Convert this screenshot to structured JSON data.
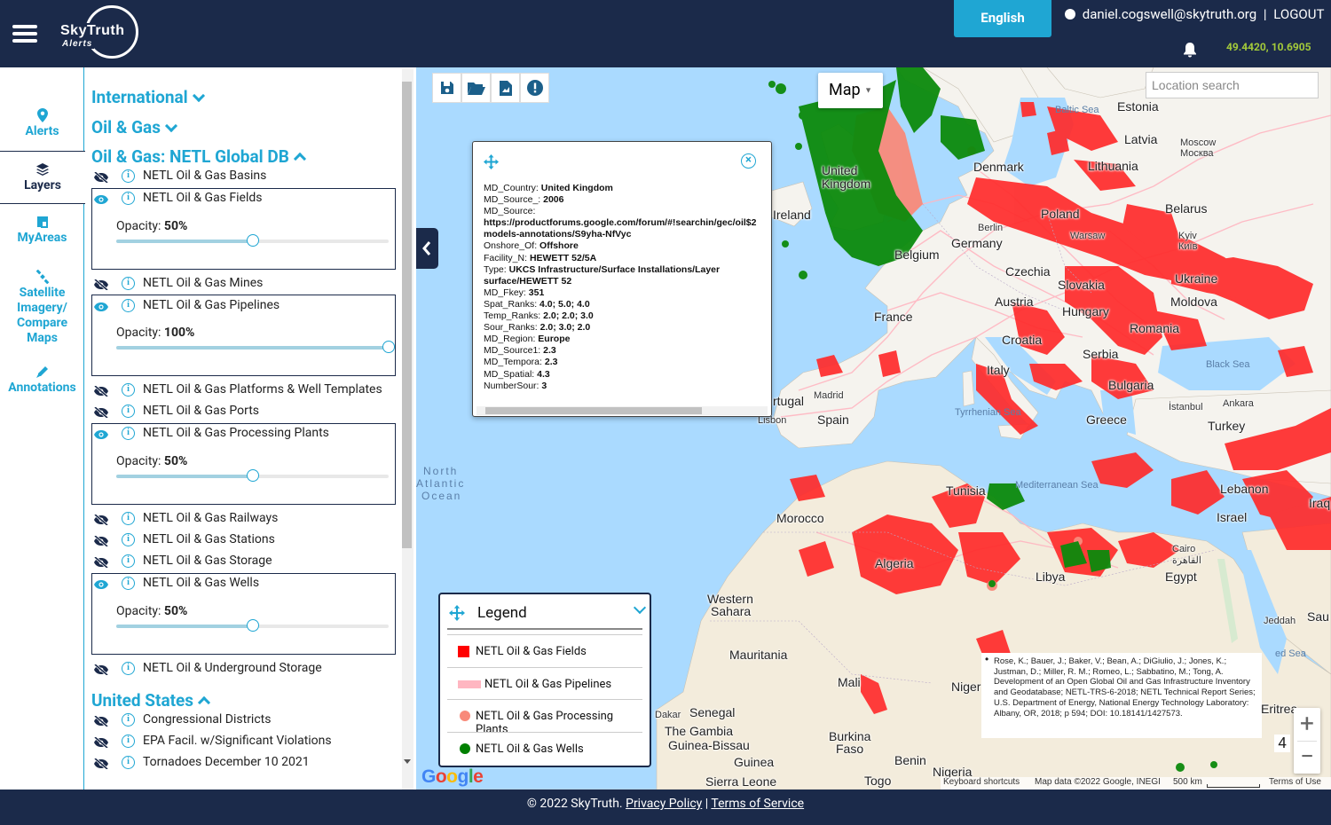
{
  "header": {
    "logo_text": "SkyTruth",
    "logo_sub": "Alerts",
    "language_button": "English",
    "user_email": "daniel.cogswell@skytruth.org",
    "separator": "|",
    "logout": "LOGOUT",
    "coordinates": "49.4420, 10.6905"
  },
  "nav": {
    "alerts": "Alerts",
    "layers": "Layers",
    "myareas": "MyAreas",
    "satellite_1": "Satellite",
    "satellite_2": "Imagery/",
    "satellite_3": "Compare",
    "satellite_4": "Maps",
    "annotations": "Annotations"
  },
  "panel": {
    "sections": {
      "international": "International",
      "oil_gas": "Oil & Gas",
      "netl": "Oil & Gas: NETL Global DB",
      "us": "United States"
    },
    "opacity_label": "Opacity:",
    "layers": [
      {
        "label": "NETL Oil & Gas Basins",
        "visible": false
      },
      {
        "label": "NETL Oil & Gas Fields",
        "visible": true,
        "opacity": "50%",
        "opacity_value": 0.5
      },
      {
        "label": "NETL Oil & Gas Mines",
        "visible": false
      },
      {
        "label": "NETL Oil & Gas Pipelines",
        "visible": true,
        "opacity": "100%",
        "opacity_value": 1.0
      },
      {
        "label": "NETL Oil & Gas Platforms & Well Templates",
        "visible": false
      },
      {
        "label": "NETL Oil & Gas Ports",
        "visible": false
      },
      {
        "label": "NETL Oil & Gas Processing Plants",
        "visible": true,
        "opacity": "50%",
        "opacity_value": 0.5
      },
      {
        "label": "NETL Oil & Gas Railways",
        "visible": false
      },
      {
        "label": "NETL Oil & Gas Stations",
        "visible": false
      },
      {
        "label": "NETL Oil & Gas Storage",
        "visible": false
      },
      {
        "label": "NETL Oil & Gas Wells",
        "visible": true,
        "opacity": "50%",
        "opacity_value": 0.5
      },
      {
        "label": "NETL Oil & Underground Storage",
        "visible": false
      }
    ],
    "us_layers": [
      {
        "label": "Congressional Districts",
        "visible": false
      },
      {
        "label": "EPA Facil. w/Significant Violations",
        "visible": false
      },
      {
        "label": "Tornadoes December 10 2021",
        "visible": false
      }
    ]
  },
  "map": {
    "type_label": "Map",
    "search_placeholder": "Location search",
    "zoom_level": "4",
    "google": "Google",
    "footer_shortcuts": "Keyboard shortcuts",
    "footer_data": "Map data ©2022 Google, INEGI",
    "footer_scale": "500 km",
    "footer_terms": "Terms of Use",
    "attribution": "Rose, K.; Bauer, J.; Baker, V.; Bean, A.; DiGiulio, J.; Jones, K.; Justman, D.; Miller, R. M.; Romeo, L.; Sabbatino, M.; Tong, A. Development of an Open Global Oil and Gas Infrastructure Inventory and Geodatabase; NETL-TRS-6-2018; NETL Technical Report Series; U.S. Department of Energy, National Energy Technology Laboratory: Albany, OR, 2018; p 594; DOI: 10.18141/1427573.",
    "labels": {
      "estonia": "Estonia",
      "latvia": "Latvia",
      "lithuania": "Lithuania",
      "moscow": "Moscow",
      "moscow_ru": "Москва",
      "belarus": "Belarus",
      "poland": "Poland",
      "warsaw": "Warsaw",
      "kyiv": "Kyiv",
      "kyiv_ua": "Київ",
      "ukraine": "Ukraine",
      "moldova": "Moldova",
      "romania": "Romania",
      "czechia": "Czechia",
      "slovakia": "Slovakia",
      "austria": "Austria",
      "hungary": "Hungary",
      "croatia": "Croatia",
      "serbia": "Serbia",
      "bulgaria": "Bulgaria",
      "istanbul": "İstanbul",
      "ankara": "Ankara",
      "turkey": "Turkey",
      "greece": "Greece",
      "italy": "Italy",
      "france": "France",
      "belgium": "Belgium",
      "germany": "Germany",
      "berlin": "Berlin",
      "denmark": "Denmark",
      "united": "United",
      "kingdom": "Kingdom",
      "ireland": "Ireland",
      "madrid": "Madrid",
      "spain": "Spain",
      "portugal": "rtugal",
      "lisbon": "Lisbon",
      "morocco": "Morocco",
      "algeria": "Algeria",
      "tunisia": "Tunisia",
      "libya": "Libya",
      "egypt": "Egypt",
      "cairo": "Cairo",
      "cairo_ar": "القاهرة",
      "lebanon": "Lebanon",
      "israel": "Israel",
      "iraq": "Iraq",
      "jeddah": "Jeddah",
      "saudi": "Sau",
      "western_sahara_1": "Western",
      "western_sahara_2": "Sahara",
      "mauritania": "Mauritania",
      "mali": "Mali",
      "niger": "Niger",
      "senegal": "Senegal",
      "dakar": "Dakar",
      "gambia": "The Gambia",
      "guinea_bissau": "Guinea-Bissau",
      "guinea": "Guinea",
      "burkina_1": "Burkina",
      "burkina_2": "Faso",
      "benin": "Benin",
      "nigeria": "Nigeria",
      "togo": "Togo",
      "sierra": "Sierra Leone",
      "eritrea": "Eritrea",
      "baltic": "Baltic Sea",
      "black_sea": "Black Sea",
      "tyrrhenian": "Tyrrhenian Sea",
      "mediterranean": "Mediterranean Sea",
      "red_sea": "ed Sea",
      "atlantic_1": "North",
      "atlantic_2": "Atlantic",
      "atlantic_3": "Ocean"
    }
  },
  "popup": {
    "fields": [
      {
        "k": "MD_Country:",
        "v": "United Kingdom"
      },
      {
        "k": "MD_Source_:",
        "v": "2006"
      },
      {
        "k": "MD_Source:",
        "v": ""
      },
      {
        "k": "",
        "v": "https://productforums.google.com/forum/#!searchin/gec/oil$2"
      },
      {
        "k": "",
        "v": "models-annotations/S9yha-NfVyc"
      },
      {
        "k": "Onshore_Of:",
        "v": "Offshore"
      },
      {
        "k": "Facility_N:",
        "v": "HEWETT 52/5A"
      },
      {
        "k": "Type:",
        "v": "UKCS Infrastructure/Surface Installations/Layer"
      },
      {
        "k": "",
        "v": "surface/HEWETT 52"
      },
      {
        "k": "MD_Fkey:",
        "v": "351"
      },
      {
        "k": "Spat_Ranks:",
        "v": "4.0; 5.0; 4.0"
      },
      {
        "k": "Temp_Ranks:",
        "v": "2.0; 2.0; 3.0"
      },
      {
        "k": "Sour_Ranks:",
        "v": "2.0; 3.0; 2.0"
      },
      {
        "k": "MD_Region:",
        "v": "Europe"
      },
      {
        "k": "MD_Source1:",
        "v": "2.3"
      },
      {
        "k": "MD_Tempora:",
        "v": "2.3"
      },
      {
        "k": "MD_Spatial:",
        "v": "4.3"
      },
      {
        "k": "NumberSour:",
        "v": "3"
      }
    ]
  },
  "legend": {
    "title": "Legend",
    "items": [
      {
        "label": "NETL Oil & Gas Fields",
        "color": "#ff0000"
      },
      {
        "label": "NETL Oil & Gas Pipelines",
        "color": "#ffb6c1"
      },
      {
        "label": "NETL Oil & Gas Processing Plants",
        "color": "#f88a7a"
      },
      {
        "label": "NETL Oil & Gas Wells",
        "color": "#008000"
      }
    ]
  },
  "footer": {
    "copyright": "© 2022 SkyTruth.",
    "privacy": "Privacy Policy",
    "sep": "|",
    "terms": "Terms of Service"
  },
  "colors": {
    "navy": "#1b2a4a",
    "accent": "#1fa6d3",
    "coords": "#a2c93a",
    "sea": "#aadaff",
    "land": "#f5f3ee",
    "desert": "#f3ecdc"
  }
}
